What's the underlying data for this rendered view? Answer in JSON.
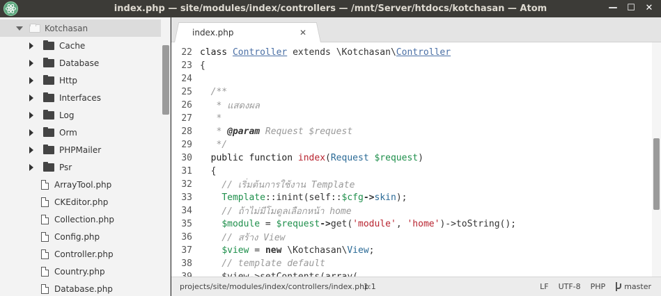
{
  "window": {
    "title": "index.php — site/modules/index/controllers — /mnt/Server/htdocs/kotchasan — Atom",
    "icon": "atom-icon",
    "controls": {
      "minimize": "—",
      "maximize": "☐",
      "close": "✕"
    }
  },
  "tree": {
    "root": {
      "label": "Kotchasan",
      "expanded": true
    },
    "folders": [
      "Cache",
      "Database",
      "Http",
      "Interfaces",
      "Log",
      "Orm",
      "PHPMailer",
      "Psr"
    ],
    "files": [
      "ArrayTool.php",
      "CKEditor.php",
      "Collection.php",
      "Config.php",
      "Controller.php",
      "Country.php",
      "Database.php"
    ]
  },
  "tab": {
    "title": "index.php",
    "close": "✕"
  },
  "editor": {
    "lines": [
      {
        "num": "22",
        "text": ""
      },
      {
        "num": "23",
        "text": "{"
      },
      {
        "num": "24",
        "text": ""
      },
      {
        "num": "25",
        "text": "  /**"
      },
      {
        "num": "26",
        "text": "   * แสดงผล"
      },
      {
        "num": "27",
        "text": "   *"
      },
      {
        "num": "28",
        "text": ""
      },
      {
        "num": "29",
        "text": "   */"
      },
      {
        "num": "30",
        "text": ""
      },
      {
        "num": "31",
        "text": "  {"
      },
      {
        "num": "32",
        "text": "    // เริ่มต้นการใช้งาน Template"
      },
      {
        "num": "33",
        "text": ""
      },
      {
        "num": "34",
        "text": "    // ถ้าไม่มีโมดูลเลือกหน้า home"
      },
      {
        "num": "35",
        "text": ""
      },
      {
        "num": "36",
        "text": "    // สร้าง View"
      },
      {
        "num": "37",
        "text": ""
      },
      {
        "num": "38",
        "text": "    // template default"
      },
      {
        "num": "39",
        "text": "    $view->setContents(array("
      }
    ],
    "line22": {
      "kw": "class ",
      "cls": "Controller",
      "ext": " extends \\Kotchasan\\",
      "parent": "Controller"
    },
    "line28": {
      "star": "   * ",
      "tag": "@param",
      "rest": " Request $request"
    },
    "line30": {
      "indent": "  ",
      "kw": "public function ",
      "fn": "index",
      "p1": "(",
      "type": "Request",
      "sp": " ",
      "var": "$request",
      "p2": ")"
    },
    "line33": {
      "indent": "    ",
      "cls": "Template",
      "op": "::",
      "fn": "inint",
      "a": "(self::",
      "var": "$cfg",
      "arrow": "->",
      "prop": "skin",
      "end": ");"
    },
    "line35": {
      "indent": "    ",
      "var1": "$module",
      "eq": " = ",
      "var2": "$request",
      "arrow": "->",
      "get": "get(",
      "s1": "'module'",
      "comma": ", ",
      "s2": "'home'",
      "end": ")->toString();"
    },
    "line37": {
      "indent": "    ",
      "var": "$view",
      "eq": " = ",
      "kw": "new",
      "ns": " \\Kotchasan\\",
      "cls": "View",
      "end": ";"
    }
  },
  "status": {
    "path": "projects/site/modules/index/controllers/index.php",
    "cursor": "1:1",
    "eol": "LF",
    "encoding": "UTF-8",
    "grammar": "PHP",
    "branch": "master"
  }
}
